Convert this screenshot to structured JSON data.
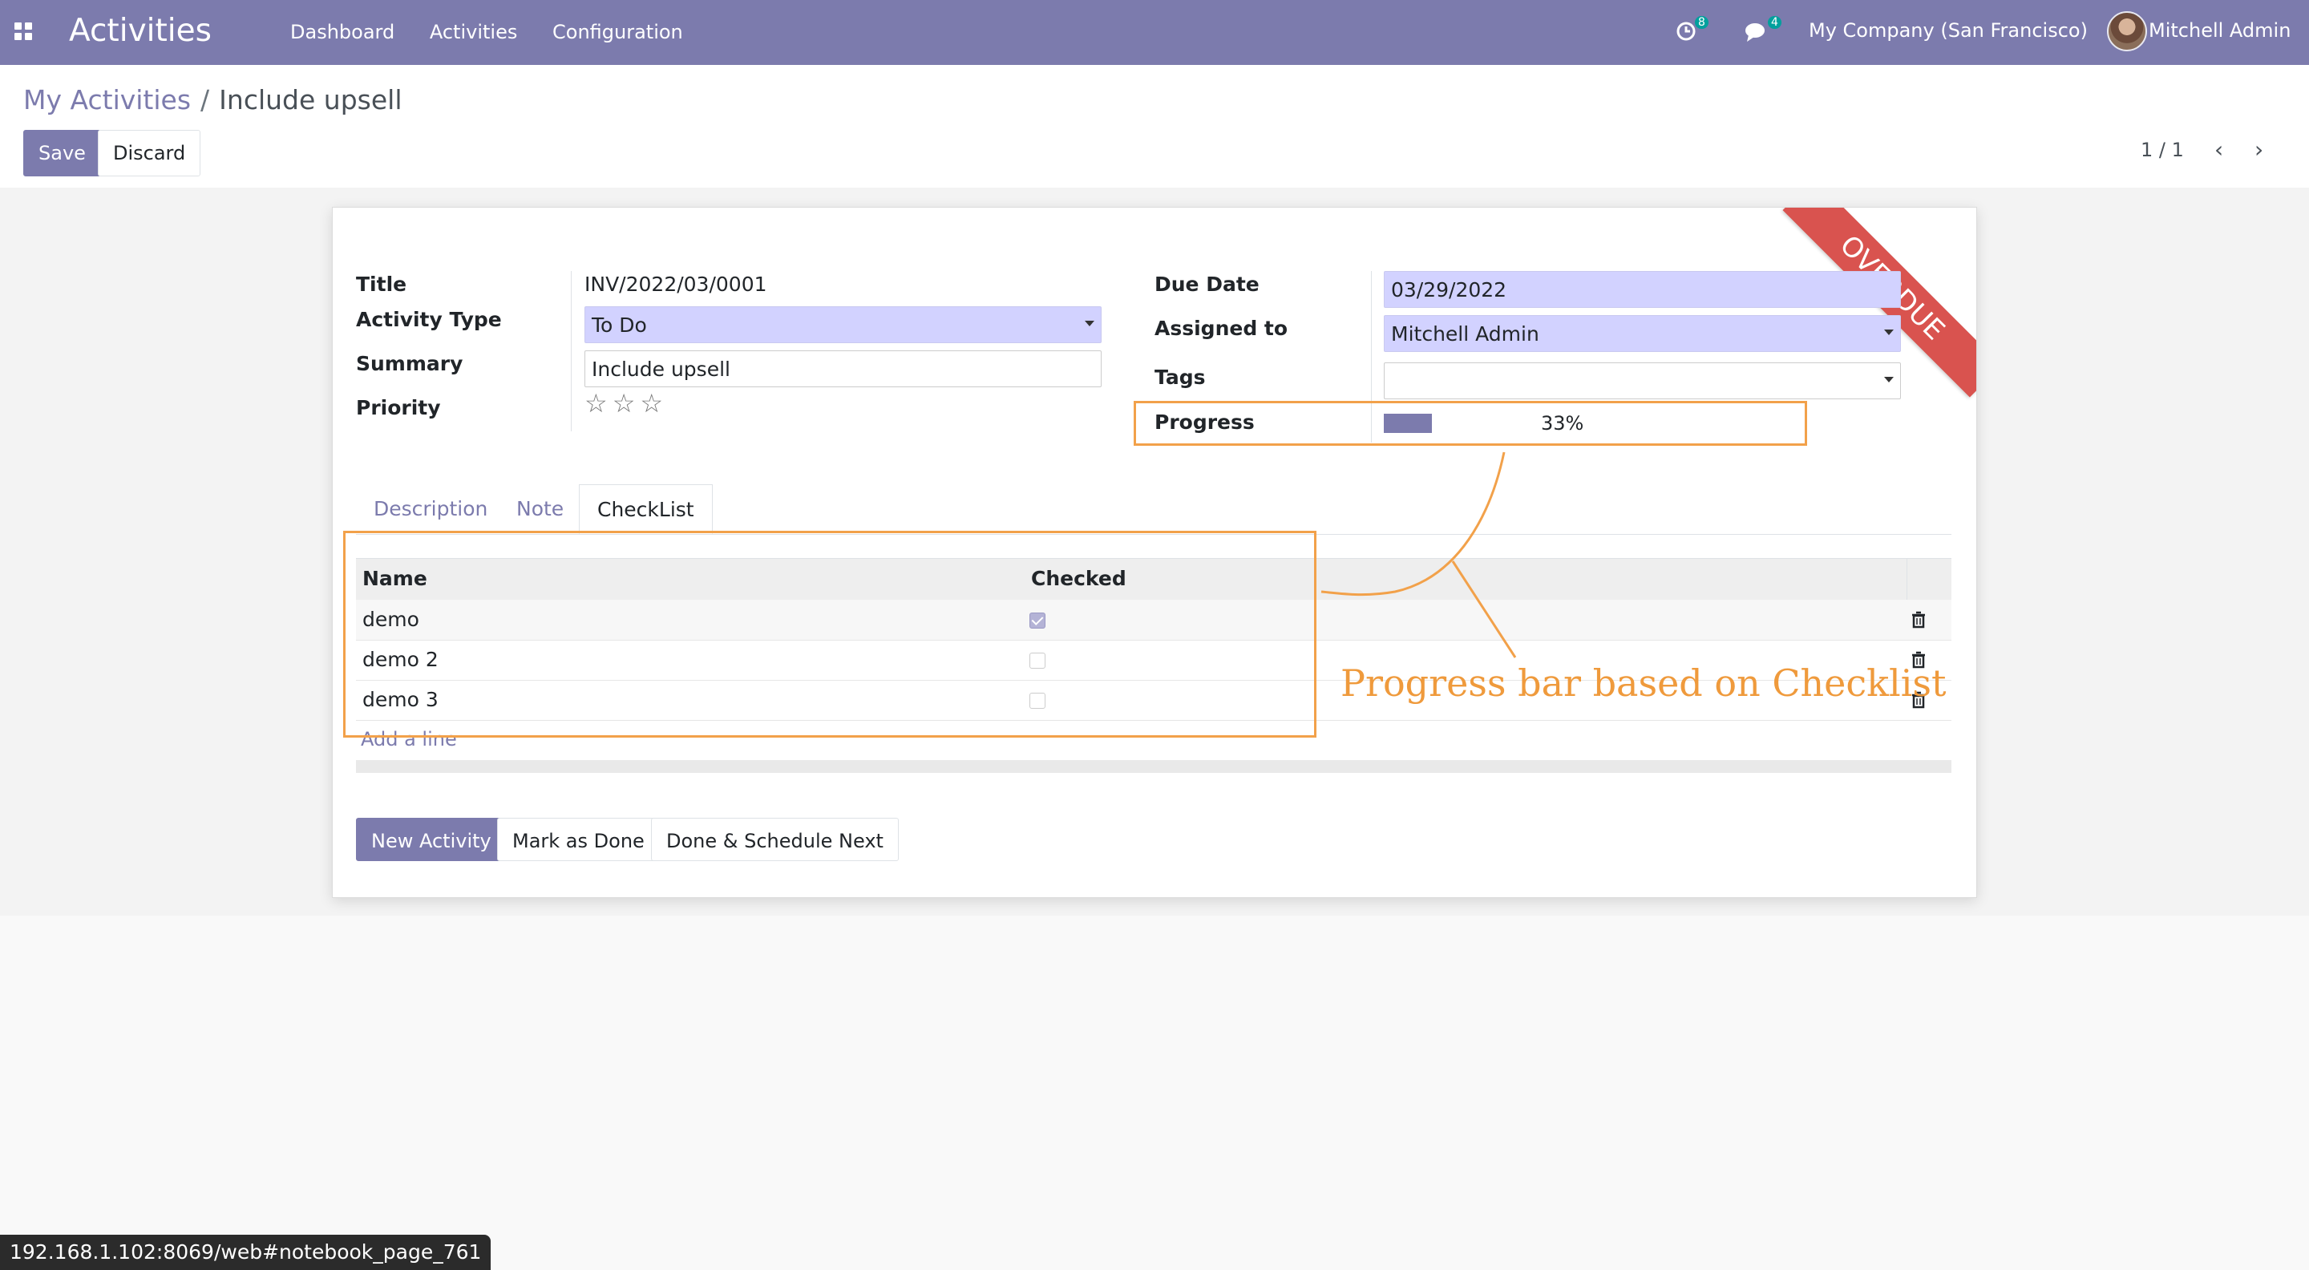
{
  "navbar": {
    "app_name": "Activities",
    "menu": [
      "Dashboard",
      "Activities",
      "Configuration"
    ],
    "activity_badge": "8",
    "message_badge": "4",
    "company": "My Company (San Francisco)",
    "user": "Mitchell Admin"
  },
  "breadcrumb": {
    "parent": "My Activities",
    "separator": "/",
    "current": "Include upsell"
  },
  "buttons": {
    "save": "Save",
    "discard": "Discard"
  },
  "pager": {
    "text": "1 / 1"
  },
  "form": {
    "title_label": "Title",
    "title_value": "INV/2022/03/0001",
    "activity_type_label": "Activity Type",
    "activity_type_value": "To Do",
    "summary_label": "Summary",
    "summary_value": "Include upsell",
    "priority_label": "Priority",
    "priority_stars": "☆☆☆",
    "due_date_label": "Due Date",
    "due_date_value": "03/29/2022",
    "assigned_label": "Assigned to",
    "assigned_value": "Mitchell Admin",
    "tags_label": "Tags",
    "tags_value": "",
    "progress_label": "Progress",
    "progress_value": 33,
    "progress_text": "33%",
    "ribbon": "OVERDUE"
  },
  "tabs": [
    {
      "label": "Description",
      "active": false
    },
    {
      "label": "Note",
      "active": false
    },
    {
      "label": "CheckList",
      "active": true
    }
  ],
  "checklist": {
    "headers": {
      "name": "Name",
      "checked": "Checked"
    },
    "rows": [
      {
        "name": "demo",
        "checked": true
      },
      {
        "name": "demo 2",
        "checked": false
      },
      {
        "name": "demo 3",
        "checked": false
      }
    ],
    "add_line": "Add a line"
  },
  "actions": {
    "new_activity": "New Activity",
    "mark_done": "Mark as Done",
    "done_schedule": "Done & Schedule Next"
  },
  "annotation": {
    "text": "Progress bar based on Checklist"
  },
  "status_url": "192.168.1.102:8069/web#notebook_page_761",
  "colors": {
    "navbar": "#7c7bad",
    "ribbon": "#d9534f",
    "annotation": "#f2a14a",
    "required_field": "#d2d2ff"
  }
}
